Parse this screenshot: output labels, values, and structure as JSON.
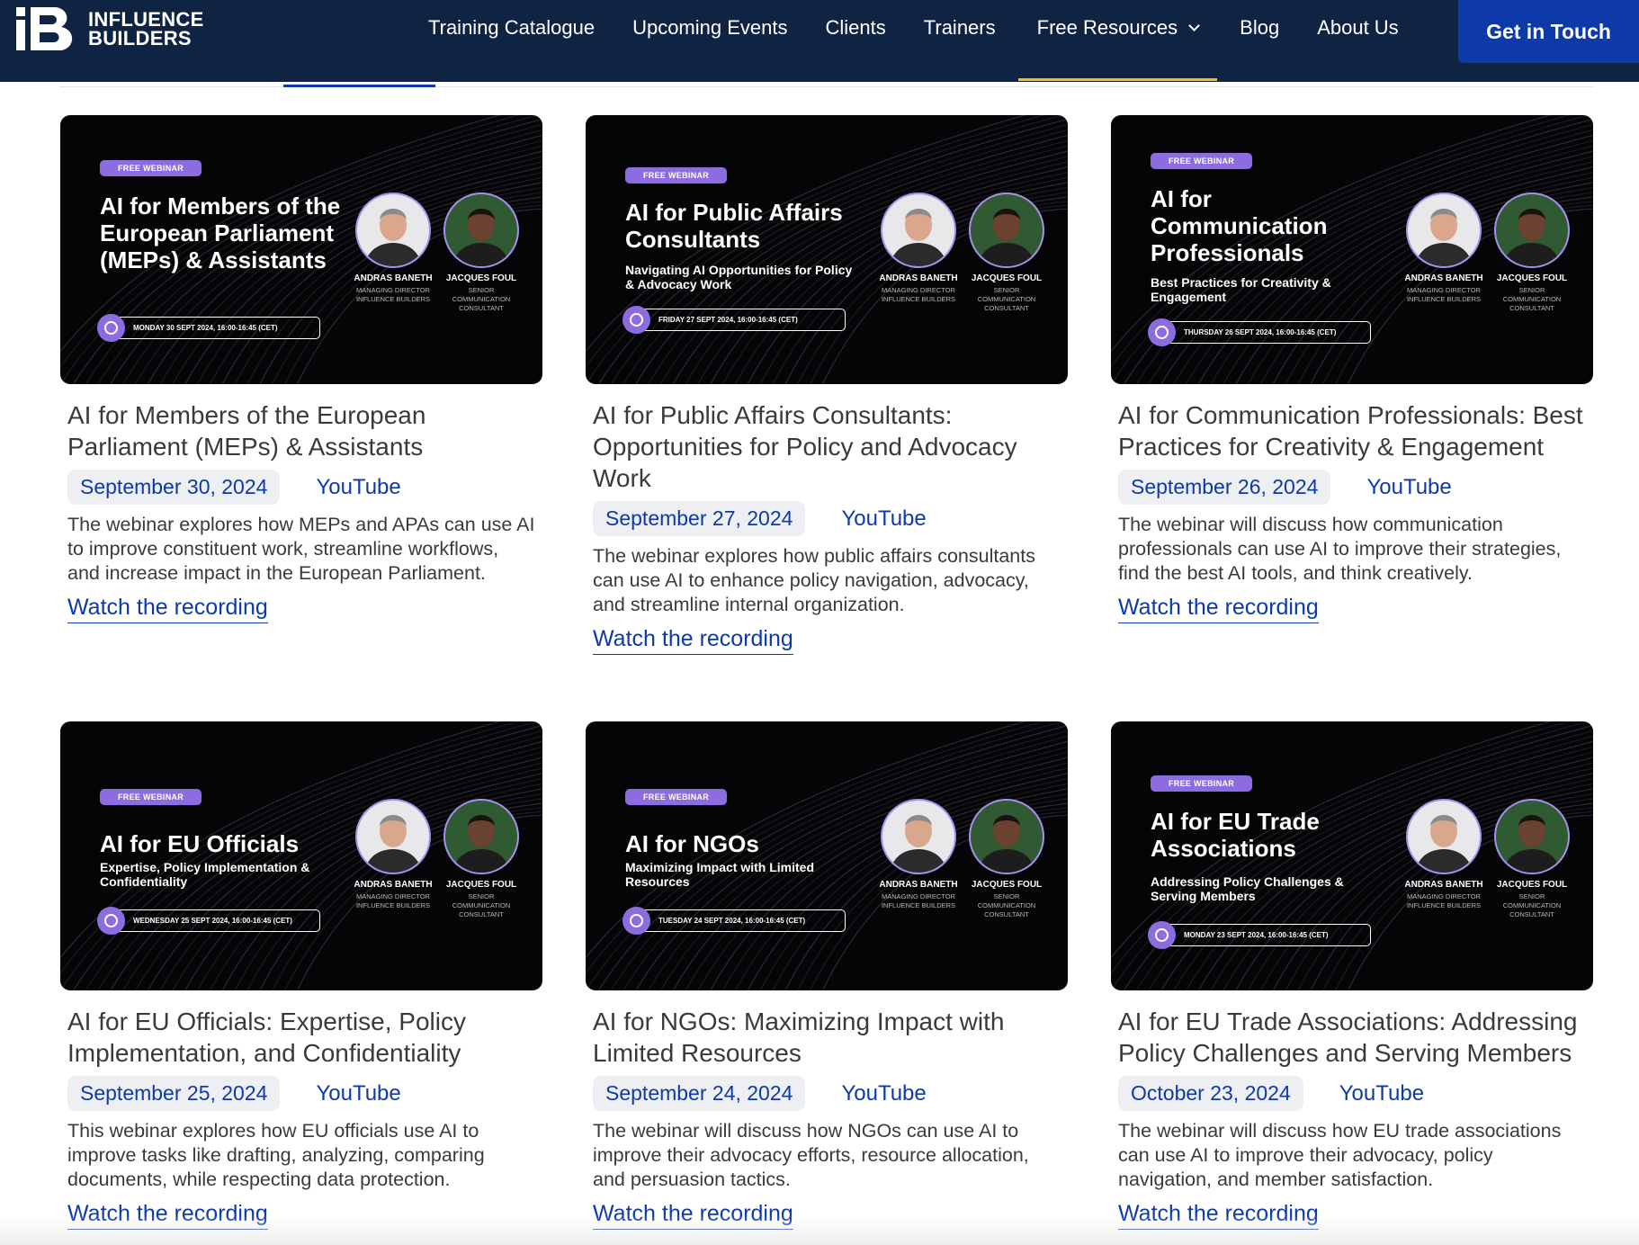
{
  "header": {
    "logo_text_line1": "INFLUENCE",
    "logo_text_line2": "BUILDERS",
    "nav": [
      {
        "label": "Training Catalogue"
      },
      {
        "label": "Upcoming Events"
      },
      {
        "label": "Clients"
      },
      {
        "label": "Trainers"
      },
      {
        "label": "Free Resources",
        "has_dropdown": true,
        "active": true
      },
      {
        "label": "Blog"
      },
      {
        "label": "About Us"
      }
    ],
    "cta_label": "Get in Touch"
  },
  "colors": {
    "header_bg": "#0f2443",
    "accent_blue": "#0d3aa8",
    "active_underline": "#f3c013",
    "badge_purple": "#8c6ce0"
  },
  "speakers": [
    {
      "name": "ANDRAS BANETH",
      "role": "MANAGING DIRECTOR INFLUENCE BUILDERS"
    },
    {
      "name": "JACQUES FOUL",
      "role": "SENIOR COMMUNICATION CONSULTANT"
    }
  ],
  "cards": [
    {
      "thumb": {
        "badge": "FREE WEBINAR",
        "title": "AI for Members of the European Parliament (MEPs) & Assistants",
        "subtitle": "",
        "date": "MONDAY 30 SEPT 2024, 16:00-16:45 (CET)"
      },
      "title": "AI for Members of the European Parliament (MEPs) & Assistants",
      "date": "September 30, 2024",
      "source": "YouTube",
      "description": "The webinar explores how MEPs and APAs can use AI to improve constituent work, streamline workflows, and increase impact in the European Parliament.",
      "link": "Watch the recording"
    },
    {
      "thumb": {
        "badge": "FREE WEBINAR",
        "title": "AI for Public Affairs Consultants",
        "subtitle": "Navigating AI Opportunities for Policy & Advocacy Work",
        "date": "FRIDAY 27 SEPT 2024, 16:00-16:45 (CET)"
      },
      "title": "AI for Public Affairs Consultants: Opportunities for Policy and Advocacy Work",
      "date": "September 27, 2024",
      "source": "YouTube",
      "description": "The webinar explores how public affairs consultants can use AI to enhance policy navigation, advocacy, and streamline internal organization.",
      "link": "Watch the recording"
    },
    {
      "thumb": {
        "badge": "FREE WEBINAR",
        "title": "AI for Communication Professionals",
        "subtitle": "Best Practices for Creativity & Engagement",
        "date": "THURSDAY 26 SEPT 2024, 16:00-16:45 (CET)"
      },
      "title": "AI for Communication Professionals: Best Practices for Creativity & Engagement",
      "date": "September 26, 2024",
      "source": "YouTube",
      "description": "The webinar will discuss how communication professionals can use AI to improve their strategies, find the best AI tools, and think creatively.",
      "link": "Watch the recording"
    },
    {
      "thumb": {
        "badge": "FREE WEBINAR",
        "title": "AI for EU Officials",
        "subtitle": "Expertise, Policy Implementation & Confidentiality",
        "date": "WEDNESDAY 25 SEPT 2024, 16:00-16:45 (CET)"
      },
      "title": "AI for EU Officials: Expertise, Policy Implementation, and Confidentiality",
      "date": "September 25, 2024",
      "source": "YouTube",
      "description": "This webinar explores how EU officials use AI to improve tasks like drafting, analyzing, comparing documents, while respecting data protection.",
      "link": "Watch the recording"
    },
    {
      "thumb": {
        "badge": "FREE WEBINAR",
        "title": "AI for NGOs",
        "subtitle": "Maximizing Impact with Limited Resources",
        "date": "TUESDAY 24 SEPT 2024, 16:00-16:45 (CET)"
      },
      "title": "AI for NGOs: Maximizing Impact with Limited Resources",
      "date": "September 24, 2024",
      "source": "YouTube",
      "description": "The webinar will discuss how NGOs can use AI to improve their advocacy efforts, resource allocation, and persuasion tactics.",
      "link": "Watch the recording"
    },
    {
      "thumb": {
        "badge": "FREE WEBINAR",
        "title": "AI for EU Trade Associations",
        "subtitle": "Addressing Policy Challenges & Serving Members",
        "date": "MONDAY 23 SEPT 2024, 16:00-16:45 (CET)"
      },
      "title": "AI for EU Trade Associations: Addressing Policy Challenges and Serving Members",
      "date": "October 23, 2024",
      "source": "YouTube",
      "description": "The webinar will discuss how EU trade associations can use AI to improve their advocacy, policy navigation, and member satisfaction.",
      "link": "Watch the recording"
    }
  ]
}
